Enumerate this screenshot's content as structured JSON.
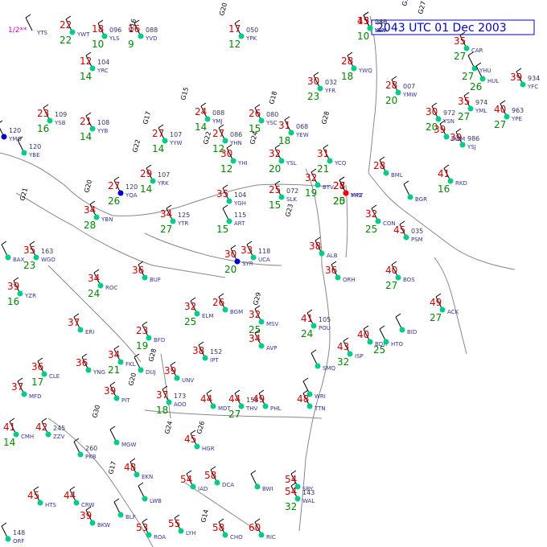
{
  "map": {
    "title": "2043 UTC 01 Dec 2003",
    "colors": {
      "temperature": "#cc0000",
      "dewpoint": "#008800",
      "boundary": "#888888",
      "title": "#0000cc",
      "weather": "#cc00cc",
      "station_clear": "#00cc88",
      "station_overcast": "#0000cc",
      "station_rain": "#ff0000"
    },
    "stations": [
      {
        "id": "YWA",
        "t": "15",
        "td": "10",
        "p": "040",
        "sky": "clear"
      },
      {
        "id": "YWT",
        "t": "22",
        "td": "22",
        "p": "",
        "sky": "clear"
      },
      {
        "id": "YTS",
        "t": "",
        "td": "",
        "p": "",
        "sky": "none",
        "wx": "1/2**"
      },
      {
        "id": "YLS",
        "t": "18",
        "td": "10",
        "p": "096",
        "sky": "clear"
      },
      {
        "id": "YVD",
        "t": "16",
        "td": "9",
        "p": "088",
        "sky": "clear"
      },
      {
        "id": "YPK",
        "t": "17",
        "td": "12",
        "p": "050",
        "sky": "clear"
      },
      {
        "id": "YRC",
        "t": "12",
        "td": "14",
        "p": "104",
        "sky": "clear"
      },
      {
        "id": "YWQ",
        "t": "28",
        "td": "18",
        "p": "",
        "sky": "clear"
      },
      {
        "id": "YHU",
        "t": "",
        "td": "27",
        "p": "",
        "sky": "clear"
      },
      {
        "id": "YFC",
        "t": "39",
        "td": "",
        "p": "934",
        "sky": "clear"
      },
      {
        "id": "YSB",
        "t": "23",
        "td": "16",
        "p": "109",
        "sky": "clear"
      },
      {
        "id": "YYB",
        "t": "21",
        "td": "14",
        "p": "108",
        "sky": "clear"
      },
      {
        "id": "YMJ",
        "t": "24",
        "td": "14",
        "p": "088",
        "sky": "clear"
      },
      {
        "id": "YSC",
        "t": "26",
        "td": "15",
        "p": "080",
        "sky": "clear"
      },
      {
        "id": "YFR",
        "t": "30",
        "td": "23",
        "p": "032",
        "sky": "clear"
      },
      {
        "id": "YMW",
        "t": "28",
        "td": "20",
        "p": "007",
        "sky": "clear"
      },
      {
        "id": "YSN",
        "t": "30",
        "td": "20",
        "p": "972",
        "sky": "clear"
      },
      {
        "id": "YML",
        "t": "35",
        "td": "27",
        "p": "974",
        "sky": "clear"
      },
      {
        "id": "YPE",
        "t": "40",
        "td": "27",
        "p": "963",
        "sky": "clear"
      },
      {
        "id": "YYW",
        "t": "27",
        "td": "14",
        "p": "107",
        "sky": "clear"
      },
      {
        "id": "YHN",
        "t": "27",
        "td": "12",
        "p": "086",
        "sky": "clear"
      },
      {
        "id": "YEW",
        "t": "31",
        "td": "18",
        "p": "068",
        "sky": "clear"
      },
      {
        "id": "YSJ",
        "t": "39",
        "td": "",
        "p": "986",
        "sky": "clear"
      },
      {
        "id": "YMO",
        "t": "",
        "td": "",
        "p": "120",
        "sky": "overcast"
      },
      {
        "id": "YBE",
        "t": "",
        "td": "",
        "p": "120",
        "sky": "clear"
      },
      {
        "id": "YRK",
        "t": "29",
        "td": "14",
        "p": "107",
        "sky": "clear"
      },
      {
        "id": "YHI",
        "t": "30",
        "td": "12",
        "p": "",
        "sky": "clear"
      },
      {
        "id": "YSL",
        "t": "32",
        "td": "20",
        "p": "",
        "sky": "clear"
      },
      {
        "id": "YCQ",
        "t": "31",
        "td": "21",
        "p": "",
        "sky": "clear"
      },
      {
        "id": "YHZ",
        "t": "28",
        "td": "20",
        "p": "",
        "sky": "rain"
      },
      {
        "id": "CAR",
        "t": "35",
        "td": "27",
        "p": "",
        "sky": "clear"
      },
      {
        "id": "HUL",
        "t": "",
        "td": "26",
        "p": "",
        "sky": "clear"
      },
      {
        "id": "YQA",
        "t": "27",
        "td": "26",
        "p": "120",
        "sky": "overcast"
      },
      {
        "id": "YBN",
        "t": "34",
        "td": "28",
        "p": "",
        "sky": "clear"
      },
      {
        "id": "YTR",
        "t": "34",
        "td": "27",
        "p": "125",
        "sky": "clear"
      },
      {
        "id": "YGH",
        "t": "35",
        "td": "",
        "p": "104",
        "sky": "clear"
      },
      {
        "id": "ART",
        "t": "",
        "td": "15",
        "p": "115",
        "sky": "clear"
      },
      {
        "id": "SLK",
        "t": "25",
        "td": "15",
        "p": "072",
        "sky": "clear"
      },
      {
        "id": "BTV",
        "t": "32",
        "td": "19",
        "p": "",
        "sky": "clear"
      },
      {
        "id": "MPV",
        "t": "27",
        "td": "25",
        "p": "",
        "sky": "rain"
      },
      {
        "id": "CON",
        "t": "32",
        "td": "25",
        "p": "",
        "sky": "clear"
      },
      {
        "id": "PWM",
        "t": "39",
        "td": "",
        "p": "",
        "sky": "clear"
      },
      {
        "id": "BML",
        "t": "28",
        "td": "",
        "p": "",
        "sky": "clear"
      },
      {
        "id": "BGR",
        "t": "",
        "td": "",
        "p": "",
        "sky": "clear"
      },
      {
        "id": "RKD",
        "t": "41",
        "td": "16",
        "p": "",
        "sky": "clear"
      },
      {
        "id": "PSM",
        "t": "45",
        "td": "",
        "p": "035",
        "sky": "clear"
      },
      {
        "id": "WGO",
        "t": "35",
        "td": "23",
        "p": "163",
        "sky": "clear"
      },
      {
        "id": "BAX",
        "t": "",
        "td": "",
        "p": "",
        "sky": "clear"
      },
      {
        "id": "YZR",
        "t": "39",
        "td": "16",
        "p": "",
        "sky": "clear"
      },
      {
        "id": "BUF",
        "t": "36",
        "td": "",
        "p": "",
        "sky": "clear"
      },
      {
        "id": "ROC",
        "t": "34",
        "td": "24",
        "p": "",
        "sky": "clear"
      },
      {
        "id": "SYR",
        "t": "30",
        "td": "20",
        "p": "",
        "sky": "overcast"
      },
      {
        "id": "UCA",
        "t": "33",
        "td": "",
        "p": "118",
        "sky": "clear"
      },
      {
        "id": "ALB",
        "t": "38",
        "td": "",
        "p": "",
        "sky": "clear"
      },
      {
        "id": "BOS",
        "t": "40",
        "td": "27",
        "p": "",
        "sky": "clear"
      },
      {
        "id": "ORH",
        "t": "36",
        "td": "",
        "p": "",
        "sky": "clear"
      },
      {
        "id": "ACK",
        "t": "49",
        "td": "27",
        "p": "",
        "sky": "clear"
      },
      {
        "id": "ERI",
        "t": "37",
        "td": "",
        "p": "",
        "sky": "clear"
      },
      {
        "id": "BFD",
        "t": "23",
        "td": "19",
        "p": "",
        "sky": "clear"
      },
      {
        "id": "ELM",
        "t": "32",
        "td": "25",
        "p": "",
        "sky": "clear"
      },
      {
        "id": "BGM",
        "t": "26",
        "td": "",
        "p": "",
        "sky": "clear"
      },
      {
        "id": "MSV",
        "t": "32",
        "td": "25",
        "p": "",
        "sky": "clear"
      },
      {
        "id": "POU",
        "t": "41",
        "td": "24",
        "p": "105",
        "sky": "clear"
      },
      {
        "id": "BDR",
        "t": "40",
        "td": "",
        "p": "",
        "sky": "clear"
      },
      {
        "id": "HTO",
        "t": "",
        "td": "25",
        "p": "",
        "sky": "clear"
      },
      {
        "id": "BID",
        "t": "",
        "td": "",
        "p": "",
        "sky": "clear"
      },
      {
        "id": "ISP",
        "t": "43",
        "td": "32",
        "p": "",
        "sky": "clear"
      },
      {
        "id": "CLE",
        "t": "36",
        "td": "17",
        "p": "",
        "sky": "clear"
      },
      {
        "id": "YNG",
        "t": "36",
        "td": "",
        "p": "",
        "sky": "clear"
      },
      {
        "id": "FKL",
        "t": "34",
        "td": "21",
        "p": "",
        "sky": "clear"
      },
      {
        "id": "DUJ",
        "t": "",
        "td": "",
        "p": "",
        "sky": "clear"
      },
      {
        "id": "IPT",
        "t": "38",
        "td": "",
        "p": "152",
        "sky": "clear"
      },
      {
        "id": "AVP",
        "t": "34",
        "td": "",
        "p": "",
        "sky": "clear"
      },
      {
        "id": "SMQ",
        "t": "",
        "td": "",
        "p": "",
        "sky": "clear"
      },
      {
        "id": "UNV",
        "t": "39",
        "td": "",
        "p": "",
        "sky": "clear"
      },
      {
        "id": "PIT",
        "t": "39",
        "td": "",
        "p": "",
        "sky": "clear"
      },
      {
        "id": "AOO",
        "t": "37",
        "td": "18",
        "p": "173",
        "sky": "clear"
      },
      {
        "id": "THV",
        "t": "44",
        "td": "27",
        "p": "158",
        "sky": "clear"
      },
      {
        "id": "MDT",
        "t": "44",
        "td": "",
        "p": "",
        "sky": "clear"
      },
      {
        "id": "PHL",
        "t": "49",
        "td": "",
        "p": "",
        "sky": "clear"
      },
      {
        "id": "TTN",
        "t": "48",
        "td": "",
        "p": "",
        "sky": "clear"
      },
      {
        "id": "WRI",
        "t": "",
        "td": "",
        "p": "",
        "sky": "clear"
      },
      {
        "id": "MFD",
        "t": "37",
        "td": "",
        "p": "",
        "sky": "clear"
      },
      {
        "id": "ZZV",
        "t": "42",
        "td": "",
        "p": "245",
        "sky": "clear"
      },
      {
        "id": "CMH",
        "t": "41",
        "td": "14",
        "p": "",
        "sky": "clear"
      },
      {
        "id": "PKB",
        "t": "",
        "td": "",
        "p": "260",
        "sky": "clear"
      },
      {
        "id": "MGW",
        "t": "",
        "td": "",
        "p": "",
        "sky": "clear"
      },
      {
        "id": "EKN",
        "t": "48",
        "td": "",
        "p": "",
        "sky": "clear"
      },
      {
        "id": "HGR",
        "t": "45",
        "td": "",
        "p": "",
        "sky": "clear"
      },
      {
        "id": "IAD",
        "t": "54",
        "td": "",
        "p": "",
        "sky": "clear"
      },
      {
        "id": "DCA",
        "t": "58",
        "td": "",
        "p": "",
        "sky": "clear"
      },
      {
        "id": "BWI",
        "t": "",
        "td": "",
        "p": "",
        "sky": "clear"
      },
      {
        "id": "SBY",
        "t": "54",
        "td": "",
        "p": "",
        "sky": "clear"
      },
      {
        "id": "WAL",
        "t": "54",
        "td": "32",
        "p": "143",
        "sky": "clear"
      },
      {
        "id": "HTS",
        "t": "45",
        "td": "",
        "p": "",
        "sky": "clear"
      },
      {
        "id": "CRW",
        "t": "44",
        "td": "",
        "p": "",
        "sky": "clear"
      },
      {
        "id": "BKW",
        "t": "39",
        "td": "",
        "p": "",
        "sky": "clear"
      },
      {
        "id": "BLF",
        "t": "",
        "td": "",
        "p": "",
        "sky": "clear"
      },
      {
        "id": "LWB",
        "t": "",
        "td": "",
        "p": "",
        "sky": "clear"
      },
      {
        "id": "ROA",
        "t": "53",
        "td": "",
        "p": "",
        "sky": "clear"
      },
      {
        "id": "LYH",
        "t": "55",
        "td": "",
        "p": "",
        "sky": "clear"
      },
      {
        "id": "CHO",
        "t": "58",
        "td": "",
        "p": "",
        "sky": "clear"
      },
      {
        "id": "RIC",
        "t": "60",
        "td": "",
        "p": "",
        "sky": "clear"
      },
      {
        "id": "ORF",
        "t": "",
        "td": "",
        "p": "148",
        "sky": "clear"
      },
      {
        "id": "LEX",
        "t": "43",
        "td": "",
        "p": "288",
        "sky": "clear"
      }
    ],
    "weather_codes": [
      "1/2**",
      "**",
      "***",
      "≡",
      "▽"
    ],
    "gusts": [
      "G15",
      "G27",
      "G16",
      "G20",
      "G15",
      "G17",
      "G18",
      "G22",
      "G24",
      "G22",
      "G20",
      "G21",
      "G23",
      "G29",
      "G28",
      "G20",
      "G30",
      "G24",
      "G26",
      "G14",
      "G17",
      "G28"
    ]
  }
}
